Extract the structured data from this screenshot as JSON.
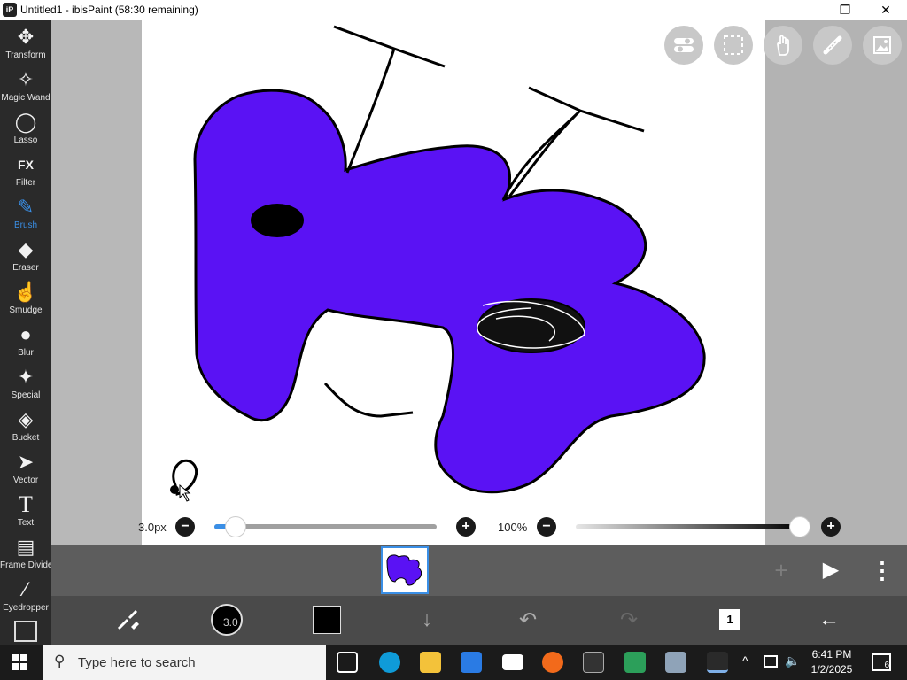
{
  "window": {
    "title": "Untitled1 - ibisPaint (58:30 remaining)",
    "app_icon_text": "iP",
    "minimize": "—",
    "maximize": "❐",
    "close": "✕"
  },
  "tools": [
    {
      "label": "Transform",
      "icon": "✥"
    },
    {
      "label": "Magic Wand",
      "icon": "✧"
    },
    {
      "label": "Lasso",
      "icon": "◯"
    },
    {
      "label": "Filter",
      "icon": "FX"
    },
    {
      "label": "Brush",
      "icon": "✎"
    },
    {
      "label": "Eraser",
      "icon": "◆"
    },
    {
      "label": "Smudge",
      "icon": "☝"
    },
    {
      "label": "Blur",
      "icon": "💧"
    },
    {
      "label": "Special",
      "icon": "✦"
    },
    {
      "label": "Bucket",
      "icon": "◈"
    },
    {
      "label": "Vector",
      "icon": "➤"
    },
    {
      "label": "Text",
      "icon": "T"
    },
    {
      "label": "Frame Divider",
      "icon": "▤"
    },
    {
      "label": "Eyedropper",
      "icon": "⁄"
    }
  ],
  "brush_size": {
    "label": "3.0px",
    "minus": "−",
    "plus": "+",
    "level": 0.03
  },
  "opacity": {
    "label": "100%",
    "minus": "−",
    "plus": "+",
    "level": 1.0
  },
  "layer_bar": {
    "add": "+",
    "play": "▶",
    "more": "⋮"
  },
  "bottom": {
    "brush_size_value": "3.0",
    "color": "#000000",
    "layers_count": "1"
  },
  "taskbar": {
    "search_placeholder": "Type here to search",
    "time": "6:41 PM",
    "date": "1/2/2025",
    "notifications": "6"
  },
  "colors": {
    "accent": "#3a8fe6",
    "shape_fill": "#5a12f4"
  }
}
